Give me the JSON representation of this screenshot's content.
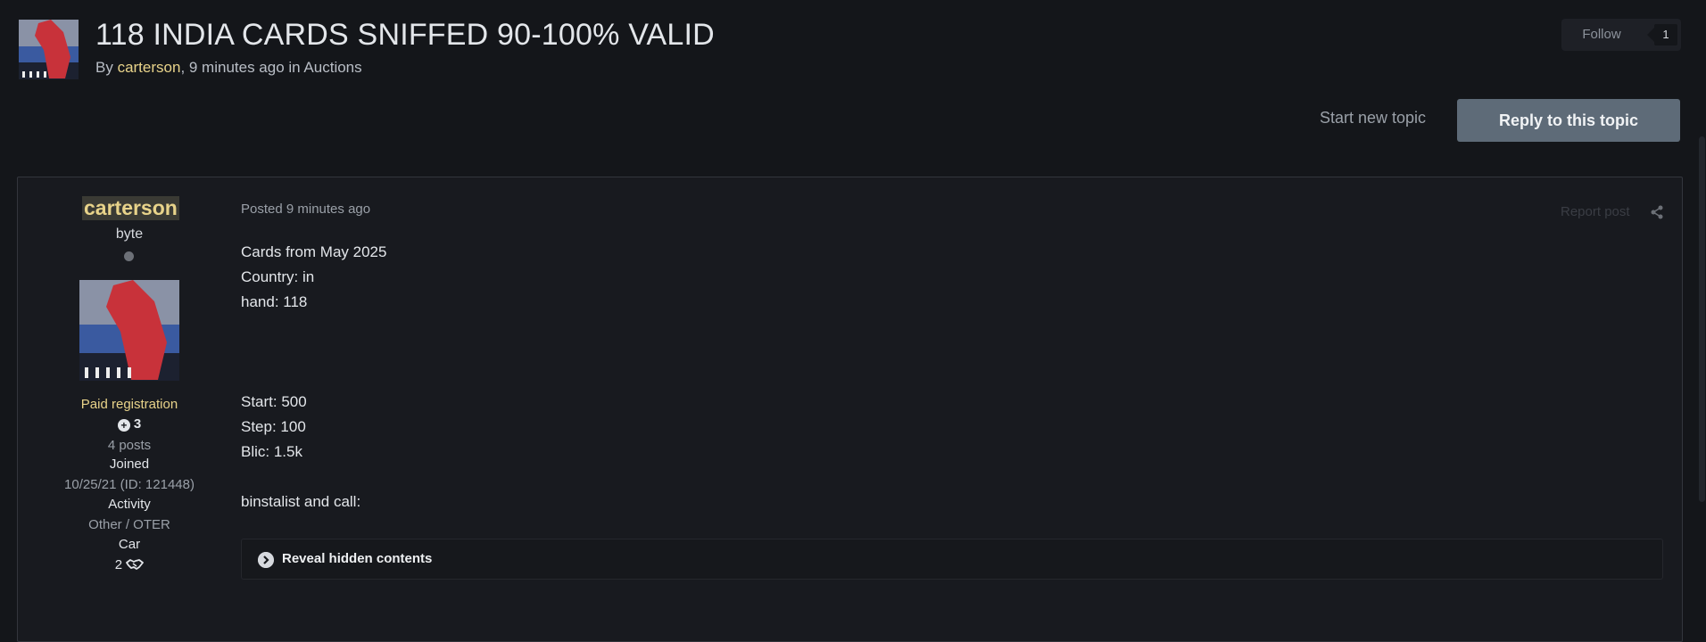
{
  "topic": {
    "title": "118 INDIA CARDS SNIFFED 90-100% VALID",
    "byline_prefix": "By ",
    "author": "carterson",
    "byline_time": ", 9 minutes ago in ",
    "forum": "Auctions"
  },
  "actions": {
    "follow_label": "Follow",
    "follow_count": "1",
    "start_new_topic": "Start new topic",
    "reply": "Reply to this topic"
  },
  "author_panel": {
    "name": "carterson",
    "rank": "byte",
    "group": "Paid registration",
    "reputation": "3",
    "posts": "4 posts",
    "joined_label": "Joined",
    "joined_value": "10/25/21 (ID: 121448)",
    "activity_label": "Activity",
    "activity_value": "Other / OTER",
    "car_label": "Car",
    "car_value": "2"
  },
  "post": {
    "posted": "Posted 9 minutes ago",
    "report": "Report post",
    "lines": [
      "Cards from May 2025",
      "Country: in",
      "hand: 118",
      "Start: 500",
      "Step: 100",
      "Blic: 1.5k",
      "binstalist and call:"
    ],
    "spoiler_label": "Reveal hidden contents"
  },
  "colors": {
    "background": "#14161a",
    "accent_author": "#e8d38a",
    "reply_button": "#5e6b78"
  },
  "icons": [
    "share-icon",
    "plus-circle-icon",
    "handshake-icon",
    "chevron-right-icon",
    "online-status-dot"
  ]
}
